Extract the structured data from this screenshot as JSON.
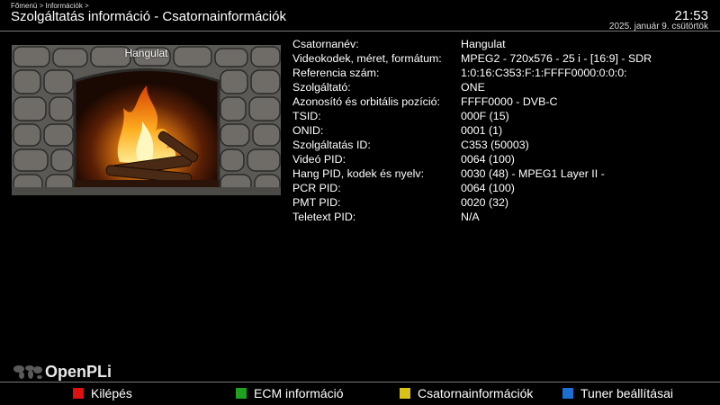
{
  "header": {
    "breadcrumb": "Főmenü > Információk >",
    "title": "Szolgáltatás információ - Csatornainformációk",
    "time": "21:53",
    "date": "2025. január  9. csütörtök"
  },
  "preview": {
    "label": "Hangulat"
  },
  "info_rows": [
    {
      "key": "Csatornanév:",
      "value": "Hangulat"
    },
    {
      "key": "Videokodek, méret, formátum:",
      "value": "MPEG2 - 720x576 - 25 i - [16:9] - SDR"
    },
    {
      "key": "Referencia szám:",
      "value": "1:0:16:C353:F:1:FFFF0000:0:0:0:"
    },
    {
      "key": "Szolgáltató:",
      "value": "ONE"
    },
    {
      "key": "Azonosító és orbitális pozíció:",
      "value": "FFFF0000 - DVB-C"
    },
    {
      "key": "TSID:",
      "value": "000F (15)"
    },
    {
      "key": "ONID:",
      "value": "0001 (1)"
    },
    {
      "key": "Szolgáltatás ID:",
      "value": "C353 (50003)"
    },
    {
      "key": "Videó PID:",
      "value": "0064 (100)"
    },
    {
      "key": "Hang PID, kodek és nyelv:",
      "value": "0030 (48) - MPEG1 Layer II -"
    },
    {
      "key": "PCR PID:",
      "value": "0064 (100)"
    },
    {
      "key": "PMT PID:",
      "value": "0020 (32)"
    },
    {
      "key": "Teletext PID:",
      "value": "N/A"
    }
  ],
  "logo": {
    "text": "OpenPLi"
  },
  "footer": {
    "red": {
      "label": "Kilépés",
      "color": "#e01010"
    },
    "green": {
      "label": "ECM információ",
      "color": "#1fa01f"
    },
    "yellow": {
      "label": "Csatornainformációk",
      "color": "#d8c21a"
    },
    "blue": {
      "label": "Tuner beállításai",
      "color": "#1a6fd0"
    }
  }
}
